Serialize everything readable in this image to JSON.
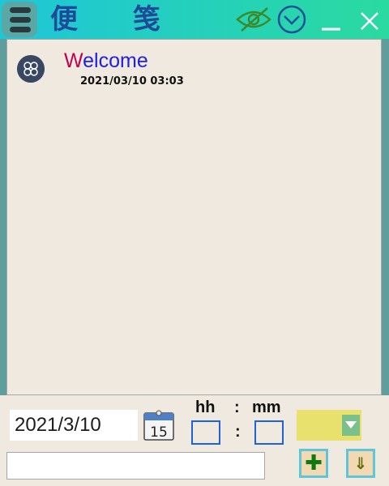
{
  "titlebar": {
    "menu_icon": "hamburger-icon",
    "app_title": "便 笺",
    "icons": [
      "eye-off-icon",
      "chevron-down-circle-icon",
      "minimize-icon",
      "close-icon"
    ]
  },
  "notes": [
    {
      "avatar_icon": "clover-icon",
      "title_first": "W",
      "title_rest": "elcome",
      "timestamp": "2021/03/10 03:03"
    }
  ],
  "composer": {
    "date_value": "2021/3/10",
    "calendar_day": "15",
    "hour_label": "hh",
    "colon": ":",
    "minute_label": "mm",
    "hour_value": "",
    "minute_value": "",
    "color_value": "",
    "note_text": "",
    "add_label": "✚",
    "download_label": "⇓"
  },
  "colors": {
    "titlebar_start": "#1ec6d8",
    "titlebar_end": "#2bdaa0",
    "content_bg": "#efe9df",
    "title_accent": "#c4004e",
    "title_main": "#2020e0",
    "select_bg": "#e8e16e"
  }
}
